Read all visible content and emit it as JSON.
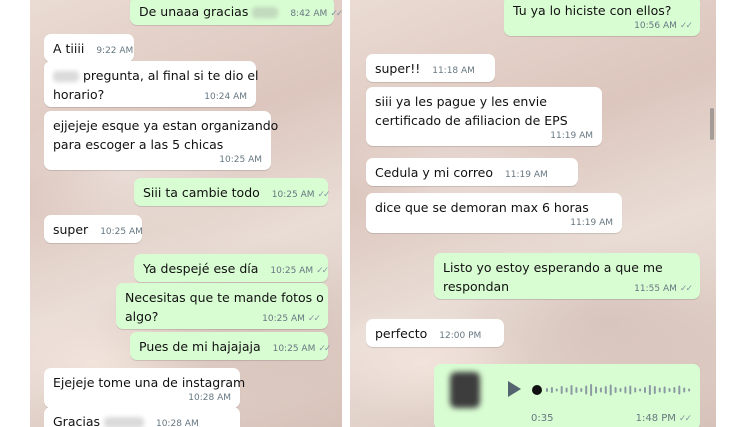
{
  "left_chat": {
    "messages": [
      {
        "text": "De unaaa gracias",
        "time": "8:42 AM"
      },
      {
        "text": "A tiiii",
        "time": "9:22 AM"
      },
      {
        "line1": "pregunta, al final si te dio el",
        "line2": "horario?",
        "time": "10:24 AM"
      },
      {
        "line1": "ejjejeje esque ya estan organizando",
        "line2": "para escoger a las 5 chicas",
        "time": "10:25 AM"
      },
      {
        "text": "Siii ta cambie todo",
        "time": "10:25 AM"
      },
      {
        "text": "super",
        "time": "10:25 AM"
      },
      {
        "text": "Ya despejé ese día",
        "time": "10:25 AM"
      },
      {
        "line1": "Necesitas que te mande fotos o",
        "line2": "algo?",
        "time": "10:25 AM"
      },
      {
        "text": "Pues de mi hajajaja",
        "time": "10:25 AM"
      },
      {
        "text": "Ejejeje tome una de instagram",
        "time": "10:28 AM"
      },
      {
        "text": "Gracias",
        "time": "10:28 AM"
      }
    ]
  },
  "right_chat": {
    "messages": [
      {
        "text": "Tu ya lo hiciste con ellos?",
        "time": "10:56 AM"
      },
      {
        "text": "super!!",
        "time": "11:18 AM"
      },
      {
        "line1": "siii ya les pague y les envie",
        "line2": "certificado de afiliacion de EPS",
        "time": "11:19 AM"
      },
      {
        "text": "Cedula y mi correo",
        "time": "11:19 AM"
      },
      {
        "text": "dice que se demoran max 6 horas",
        "time": "11:19 AM"
      },
      {
        "line1": "Listo yo estoy esperando a que me",
        "line2": "respondan",
        "time": "11:55 AM"
      },
      {
        "text": "perfecto",
        "time": "12:00 PM"
      }
    ],
    "voice_note": {
      "duration": "0:35",
      "time": "1:48 PM"
    }
  },
  "icons": {
    "read_receipt": "double-check-icon",
    "play": "play-icon"
  },
  "colors": {
    "incoming": "#ffffff",
    "outgoing": "#d9fdd3",
    "meta": "#667781"
  }
}
